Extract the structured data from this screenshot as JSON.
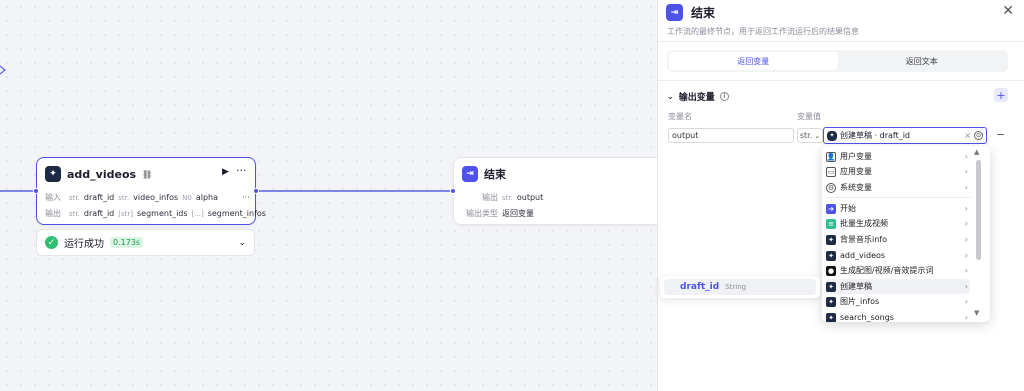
{
  "canvas": {
    "add_videos_node": {
      "title": "add_videos",
      "input_label": "输入",
      "inputs": [
        {
          "type": "str.",
          "name": "draft_id"
        },
        {
          "type": "str.",
          "name": "video_infos"
        },
        {
          "type": "N0",
          "name": "alpha"
        }
      ],
      "more": "···",
      "output_label": "输出",
      "outputs": [
        {
          "type": "str.",
          "name": "draft_id"
        },
        {
          "type": "[str]",
          "name": "segment_ids"
        },
        {
          "type": "[...]",
          "name": "segment_infos"
        }
      ]
    },
    "status": {
      "text": "运行成功",
      "time": "0.173s"
    },
    "end_node": {
      "title": "结束",
      "output_label": "输出",
      "output_type": "str.",
      "output_name": "output",
      "output_kind_label": "输出类型",
      "output_kind": "返回变量"
    },
    "popover": {
      "var": "draft_id",
      "type": "String"
    }
  },
  "panel": {
    "title": "结束",
    "description": "工作流的最终节点，用于返回工作流运行后的结果信息",
    "tabs": [
      {
        "label": "返回变量",
        "active": true
      },
      {
        "label": "返回文本",
        "active": false
      }
    ],
    "section_title": "输出变量",
    "col_name": "变量名",
    "col_value": "变量值",
    "row": {
      "name": "output",
      "type": "str.",
      "ref": "创建草稿 · draft_id"
    },
    "dropdown": [
      {
        "label": "用户变量",
        "icon": "user-icon"
      },
      {
        "label": "应用变量",
        "icon": "folder-icon"
      },
      {
        "label": "系统变量",
        "icon": "gear-icon"
      },
      {
        "label": "开始",
        "icon": "start-icon"
      },
      {
        "label": "批量生成视频",
        "icon": "batch-icon"
      },
      {
        "label": "背景音乐info",
        "icon": "plugin-icon"
      },
      {
        "label": "add_videos",
        "icon": "plugin-icon"
      },
      {
        "label": "生成配图/视频/音效提示词",
        "icon": "llm-icon"
      },
      {
        "label": "创建草稿",
        "icon": "plugin-icon"
      },
      {
        "label": "图片_infos",
        "icon": "plugin-icon"
      },
      {
        "label": "search_songs",
        "icon": "plugin-icon"
      }
    ]
  }
}
